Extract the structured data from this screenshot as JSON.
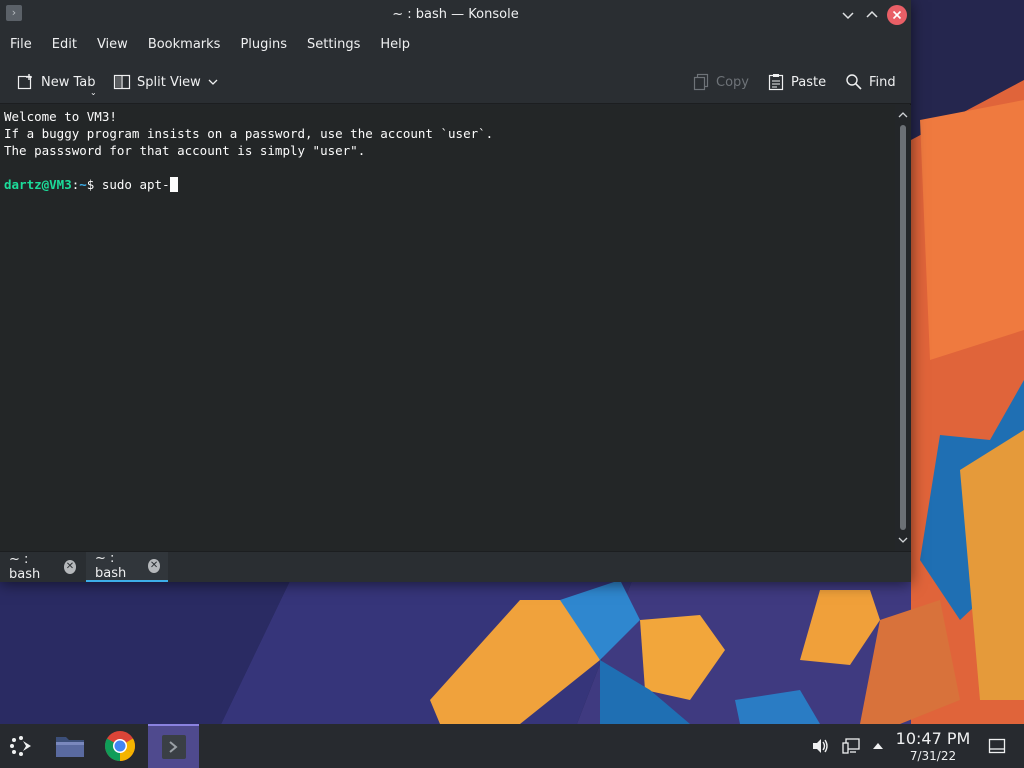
{
  "window": {
    "title": "~ : bash — Konsole",
    "icons": {
      "app": "terminal-icon",
      "minimize": "chevron-down-icon",
      "maximize": "chevron-up-icon",
      "close": "close-icon"
    }
  },
  "menubar": {
    "items": [
      "File",
      "Edit",
      "View",
      "Bookmarks",
      "Plugins",
      "Settings",
      "Help"
    ]
  },
  "toolbar": {
    "new_tab": "New Tab",
    "split_view": "Split View",
    "copy": "Copy",
    "paste": "Paste",
    "find": "Find"
  },
  "terminal": {
    "lines": [
      "Welcome to VM3!",
      "If a buggy program insists on a password, use the account `user`.",
      "The passsword for that account is simply \"user\"."
    ],
    "prompt_user": "dartz@VM3",
    "prompt_sep": ":",
    "prompt_path": "~",
    "prompt_symbol": "$",
    "command": "sudo apt-"
  },
  "tabs": [
    {
      "label": "~ : bash",
      "active": false
    },
    {
      "label": "~ : bash",
      "active": true
    }
  ],
  "taskbar": {
    "time": "10:47 PM",
    "date": "7/31/22",
    "apps": [
      "launcher-icon",
      "file-manager-icon",
      "chrome-icon",
      "konsole-icon"
    ]
  },
  "colors": {
    "accent": "#3daee9",
    "prompt_user": "#1cdc9a",
    "close_button": "#e95f66",
    "active_task": "#4f4a8e"
  }
}
